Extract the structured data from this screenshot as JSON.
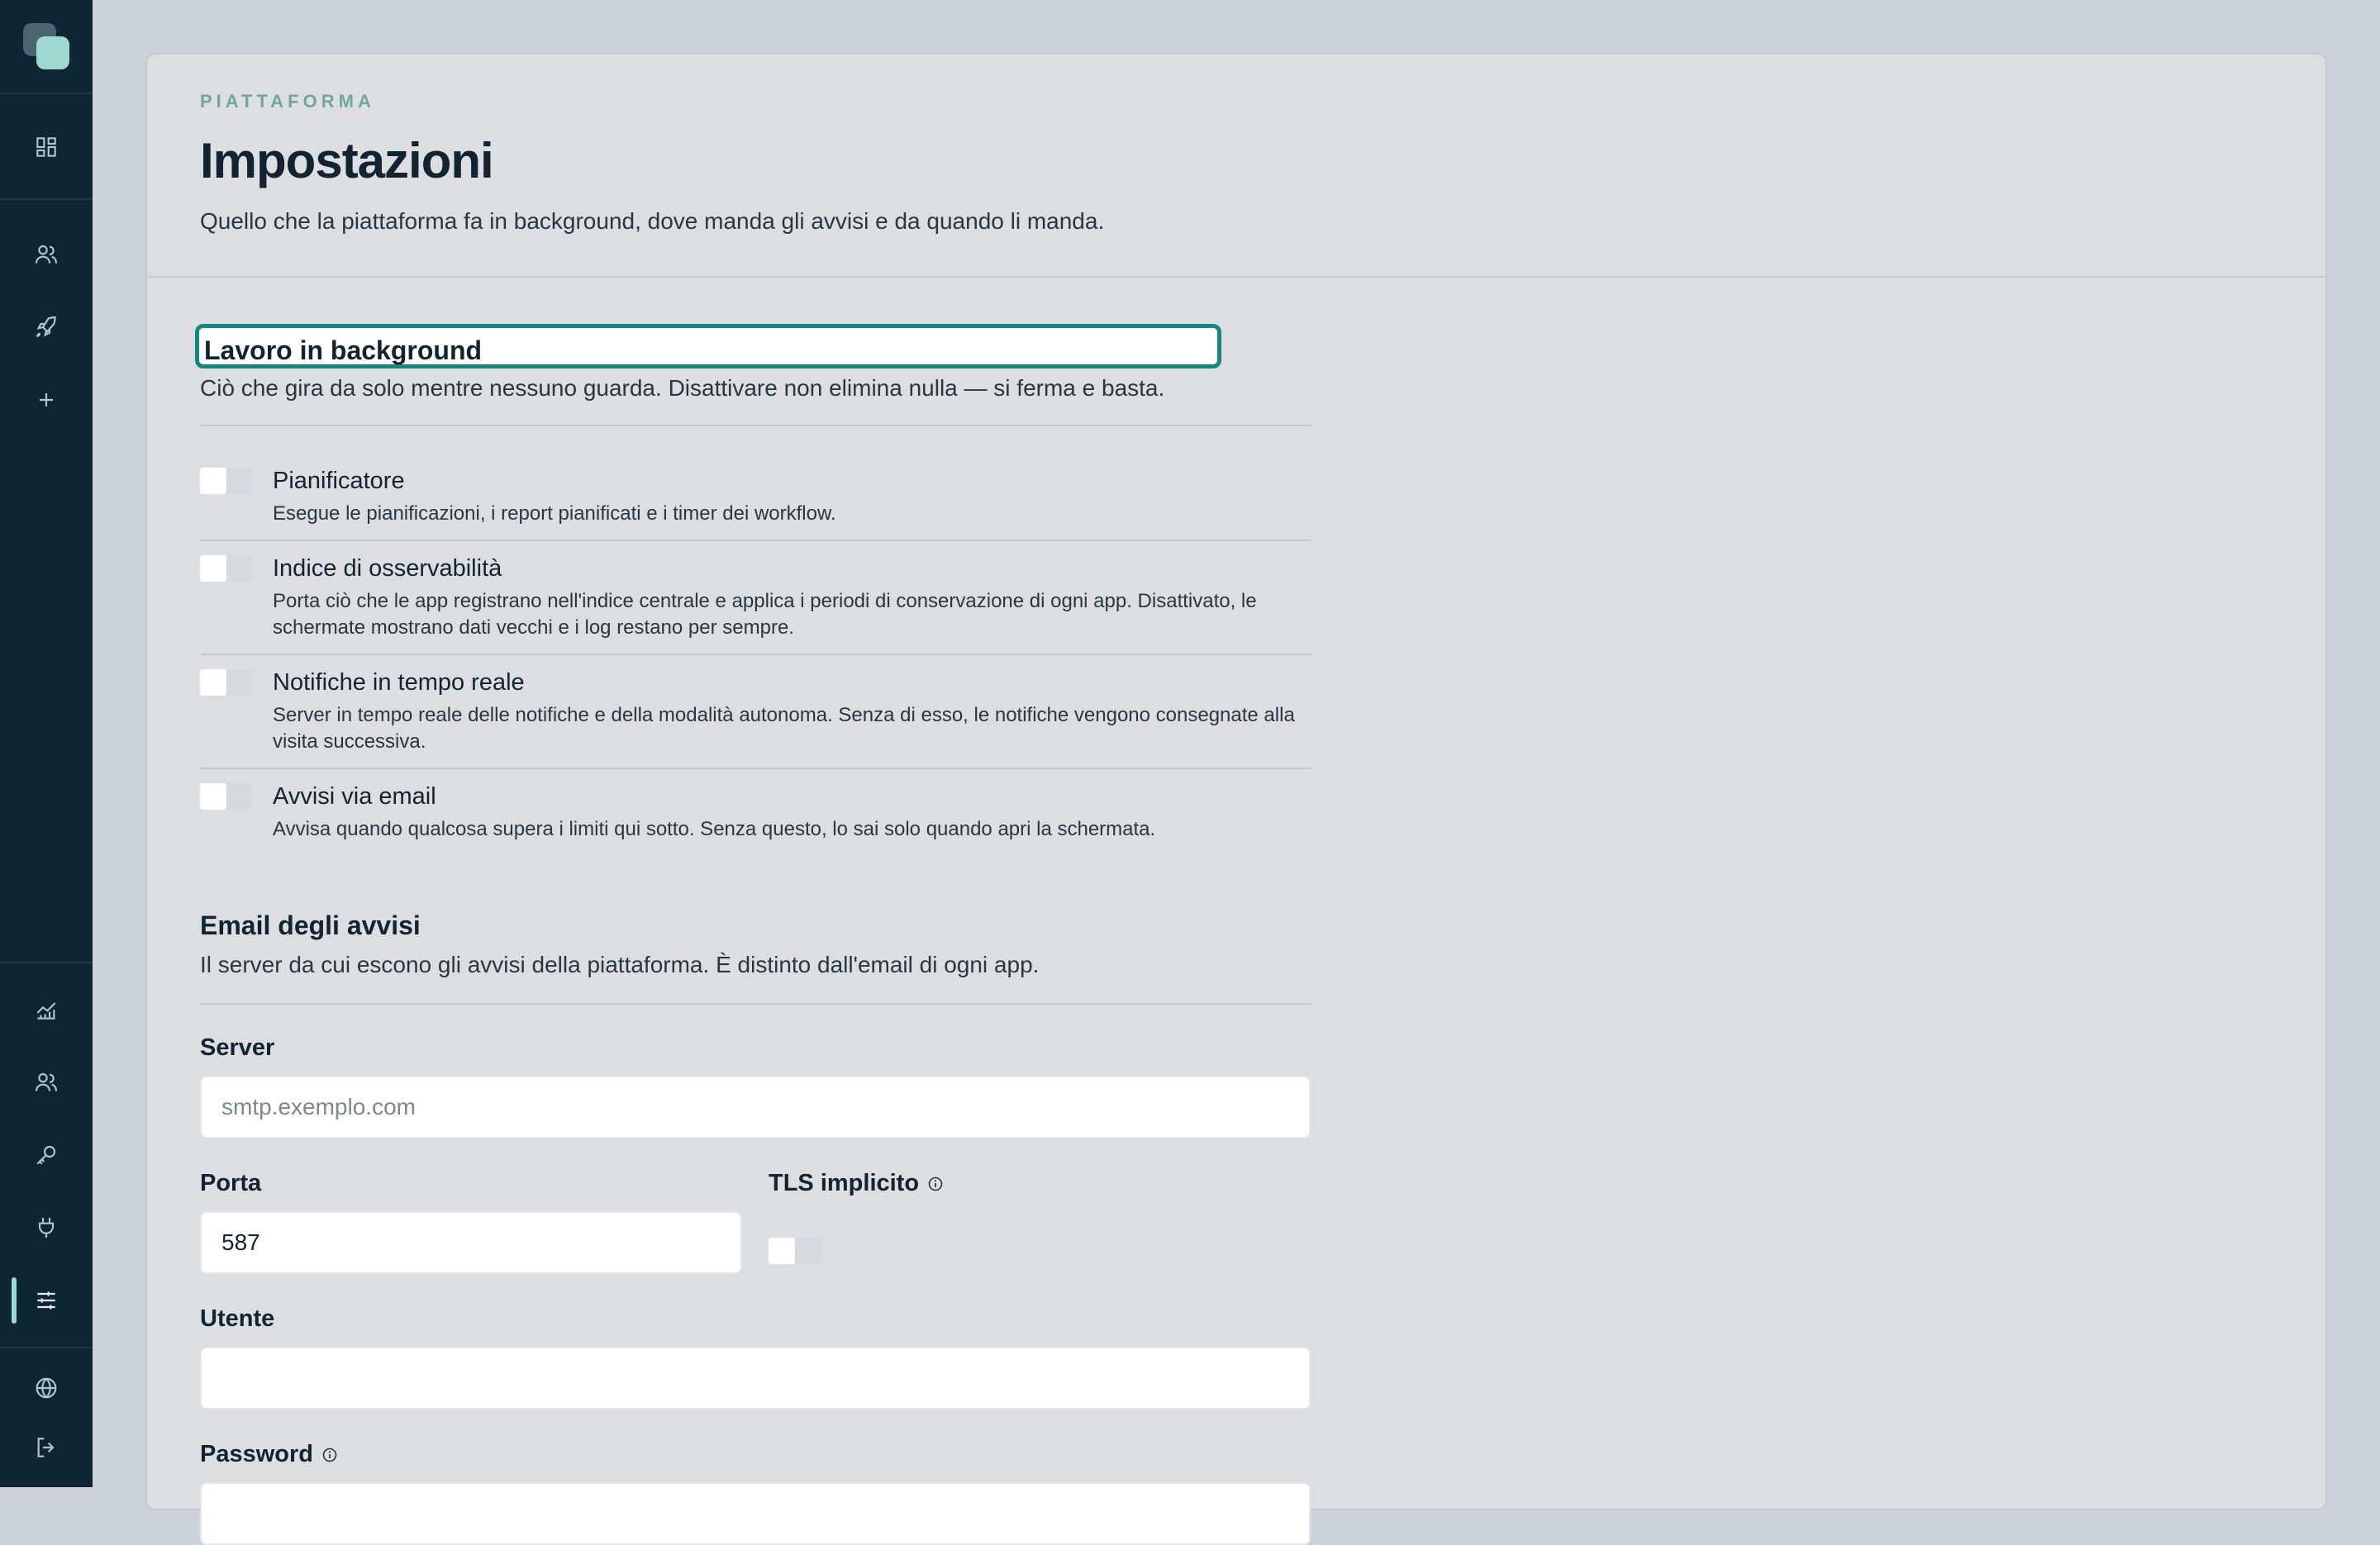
{
  "header": {
    "eyebrow": "PIATTAFORMA",
    "title": "Impostazioni",
    "subtitle": "Quello che la piattaforma fa in background, dove manda gli avvisi e da quando li manda."
  },
  "background_section": {
    "title": "Lavoro in background",
    "description": "Ciò che gira da solo mentre nessuno guarda. Disattivare non elimina nulla — si ferma e basta.",
    "items": [
      {
        "title": "Pianificatore",
        "description": "Esegue le pianificazioni, i report pianificati e i timer dei workflow.",
        "enabled": false
      },
      {
        "title": "Indice di osservabilità",
        "description": "Porta ciò che le app registrano nell'indice centrale e applica i periodi di conservazione di ogni app. Disattivato, le schermate mostrano dati vecchi e i log restano per sempre.",
        "enabled": false
      },
      {
        "title": "Notifiche in tempo reale",
        "description": "Server in tempo reale delle notifiche e della modalità autonoma. Senza di esso, le notifiche vengono consegnate alla visita successiva.",
        "enabled": false
      },
      {
        "title": "Avvisi via email",
        "description": "Avvisa quando qualcosa supera i limiti qui sotto. Senza questo, lo sai solo quando apri la schermata.",
        "enabled": false
      }
    ]
  },
  "email_section": {
    "title": "Email degli avvisi",
    "description": "Il server da cui escono gli avvisi della piattaforma. È distinto dall'email di ogni app.",
    "server": {
      "label": "Server",
      "value": "",
      "placeholder": "smtp.exemplo.com"
    },
    "port": {
      "label": "Porta",
      "value": "587"
    },
    "tls": {
      "label": "TLS implicito",
      "enabled": false
    },
    "user": {
      "label": "Utente",
      "value": ""
    },
    "password": {
      "label": "Password"
    }
  },
  "sidebar": {
    "top_icons": [
      "dashboard-icon",
      "users-icon",
      "rocket-icon",
      "plus-icon"
    ],
    "bottom_icons": [
      "chart-icon",
      "team-icon",
      "key-icon",
      "plug-icon",
      "sliders-icon"
    ],
    "footer_icons": [
      "globe-icon",
      "logout-icon"
    ],
    "active": "sliders-icon"
  },
  "colors": {
    "sidebar_bg": "#0e2633",
    "accent": "#17877b",
    "accent_light": "#9fd8d0",
    "card_bg": "#dcdee2",
    "page_bg": "#cdd2da"
  }
}
